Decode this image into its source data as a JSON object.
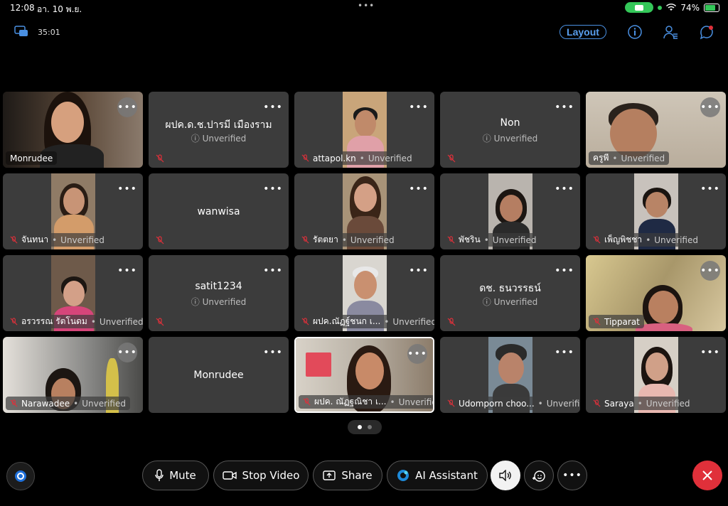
{
  "status_bar": {
    "time": "12:08",
    "date": "อา. 10 พ.ย.",
    "dots": "•••",
    "battery": "74%"
  },
  "topbar": {
    "timer": "35:01",
    "layout_label": "Layout"
  },
  "colors": {
    "accent": "#4a90e2",
    "tile_bg": "#3c3c3c",
    "mute_red": "#e0303a",
    "green": "#34c759"
  },
  "participants": [
    {
      "name": "Monrudee",
      "has_video": true
    },
    {
      "name": "ผปค.ด.ช.ปารมี เมืองราม",
      "unverified": "Unverified",
      "has_video": false
    },
    {
      "name": "attapol.kn",
      "unverified": "Unverified",
      "has_video": true
    },
    {
      "name": "Non",
      "unverified": "Unverified",
      "has_video": false
    },
    {
      "name": "ครูพี",
      "unverified": "Unverified",
      "has_video": true
    },
    {
      "name": "จันทนา",
      "unverified": "Unverified",
      "has_video": true
    },
    {
      "name": "wanwisa",
      "has_video": false
    },
    {
      "name": "รัตตยา",
      "unverified": "Unverified",
      "has_video": true
    },
    {
      "name": "พัชริน",
      "unverified": "Unverified",
      "has_video": true
    },
    {
      "name": "เพ็ญพิชชา",
      "unverified": "Unverified",
      "has_video": true
    },
    {
      "name": "อรวรรณ รัตโนดม",
      "unverified": "Unverified",
      "has_video": true
    },
    {
      "name": "satit1234",
      "unverified": "Unverified",
      "has_video": false
    },
    {
      "name": "ผปค.ณัฏฐ์ชนก  เ...",
      "unverified": "Unverified",
      "has_video": true
    },
    {
      "name": "ดช. ธนวรรธน์",
      "unverified": "Unverified",
      "has_video": false
    },
    {
      "name": "Tipparat",
      "has_video": true
    },
    {
      "name": "Narawadee",
      "unverified": "Unverified",
      "has_video": true
    },
    {
      "name": "Monrudee",
      "has_video": false
    },
    {
      "name": "ผปค. ณัฏฐณิชา  เ...",
      "unverified": "Unverified",
      "has_video": true
    },
    {
      "name": "Udomporn choo...",
      "unverified": "Unverified",
      "has_video": true
    },
    {
      "name": "Saraya",
      "unverified": "Unverified",
      "has_video": true
    }
  ],
  "controls": {
    "mute": "Mute",
    "stop_video": "Stop Video",
    "share": "Share",
    "ai_assistant": "AI Assistant"
  }
}
